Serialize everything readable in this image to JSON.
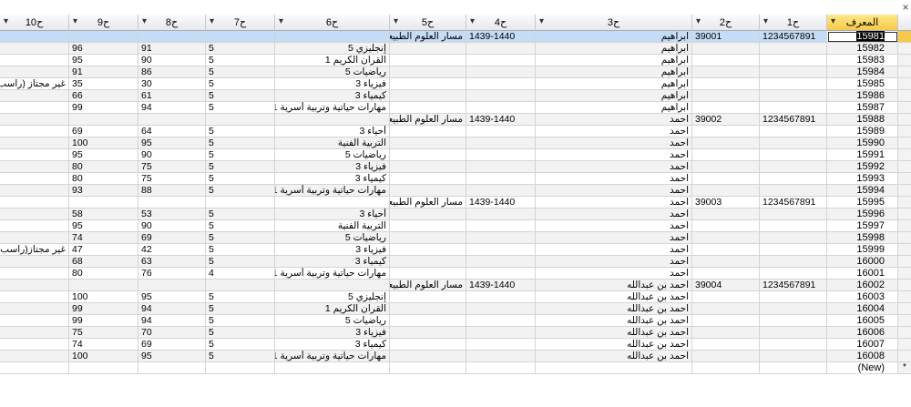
{
  "window": {
    "close_glyph": "×"
  },
  "columns": [
    "ﺍﻟﻤﻌﺮﻑ",
    "ﺡ1",
    "ﺡ2",
    "ﺡ3",
    "ﺡ4",
    "ﺡ5",
    "ﺡ6",
    "ﺡ7",
    "ﺡ8",
    "ﺡ9",
    "ﺡ10"
  ],
  "sort_arrow": "▾",
  "rows": [
    [
      "15981",
      "1234567891",
      "39001",
      "ابراهيم",
      "1439-1440",
      "مسار العلوم الطبيعية",
      "",
      "",
      "",
      "",
      ""
    ],
    [
      "15982",
      "",
      "",
      "ابراهيم",
      "",
      "",
      "إنجليزي 5",
      "5",
      "91",
      "96",
      ""
    ],
    [
      "15983",
      "",
      "",
      "ابراهيم",
      "",
      "",
      "القران الكريم 1",
      "5",
      "90",
      "95",
      ""
    ],
    [
      "15984",
      "",
      "",
      "ابراهيم",
      "",
      "",
      "رياضيات 5",
      "5",
      "86",
      "91",
      ""
    ],
    [
      "15985",
      "",
      "",
      "ابراهيم",
      "",
      "",
      "فيزياء 3",
      "5",
      "30",
      "35",
      "غير مجتاز (راسب)"
    ],
    [
      "15986",
      "",
      "",
      "ابراهيم",
      "",
      "",
      "كيمياء 3",
      "5",
      "61",
      "66",
      ""
    ],
    [
      "15987",
      "",
      "",
      "ابراهيم",
      "",
      "",
      "مهارات حياتية وتربية أسرية 1",
      "5",
      "94",
      "99",
      ""
    ],
    [
      "15988",
      "1234567891",
      "39002",
      "احمد",
      "1439-1440",
      "مسار العلوم الطبيعية",
      "",
      "",
      "",
      "",
      ""
    ],
    [
      "15989",
      "",
      "",
      "احمد",
      "",
      "",
      "أحياء 3",
      "5",
      "64",
      "69",
      ""
    ],
    [
      "15990",
      "",
      "",
      "احمد",
      "",
      "",
      "التربية الفنية",
      "5",
      "95",
      "100",
      ""
    ],
    [
      "15991",
      "",
      "",
      "احمد",
      "",
      "",
      "رياضيات 5",
      "5",
      "90",
      "95",
      ""
    ],
    [
      "15992",
      "",
      "",
      "احمد",
      "",
      "",
      "فيزياء 3",
      "5",
      "75",
      "80",
      ""
    ],
    [
      "15993",
      "",
      "",
      "احمد",
      "",
      "",
      "كيمياء 3",
      "5",
      "75",
      "80",
      ""
    ],
    [
      "15994",
      "",
      "",
      "احمد",
      "",
      "",
      "مهارات حياتية وتربية أسرية 1",
      "5",
      "88",
      "93",
      ""
    ],
    [
      "15995",
      "1234567891",
      "39003",
      "احمد",
      "1439-1440",
      "مسار العلوم الطبيعية",
      "",
      "",
      "",
      "",
      ""
    ],
    [
      "15996",
      "",
      "",
      "احمد",
      "",
      "",
      "أحياء 3",
      "5",
      "53",
      "58",
      ""
    ],
    [
      "15997",
      "",
      "",
      "احمد",
      "",
      "",
      "التربية الفنية",
      "5",
      "90",
      "95",
      ""
    ],
    [
      "15998",
      "",
      "",
      "احمد",
      "",
      "",
      "رياضيات 5",
      "5",
      "69",
      "74",
      ""
    ],
    [
      "15999",
      "",
      "",
      "احمد",
      "",
      "",
      "فيزياء 3",
      "5",
      "42",
      "47",
      "غير مجتاز(راسب)"
    ],
    [
      "16000",
      "",
      "",
      "احمد",
      "",
      "",
      "كيمياء 3",
      "5",
      "63",
      "68",
      ""
    ],
    [
      "16001",
      "",
      "",
      "احمد",
      "",
      "",
      "مهارات حياتية وتربية أسرية 1",
      "4",
      "76",
      "80",
      ""
    ],
    [
      "16002",
      "1234567891",
      "39004",
      "احمد بن عبدالله",
      "1439-1440",
      "مسار العلوم الطبيعية",
      "",
      "",
      "",
      "",
      ""
    ],
    [
      "16003",
      "",
      "",
      "احمد بن عبدالله",
      "",
      "",
      "إنجليزي 5",
      "5",
      "95",
      "100",
      ""
    ],
    [
      "16004",
      "",
      "",
      "احمد بن عبدالله",
      "",
      "",
      "القران الكريم 1",
      "5",
      "94",
      "99",
      ""
    ],
    [
      "16005",
      "",
      "",
      "احمد بن عبدالله",
      "",
      "",
      "رياضيات 5",
      "5",
      "94",
      "99",
      ""
    ],
    [
      "16006",
      "",
      "",
      "احمد بن عبدالله",
      "",
      "",
      "فيزياء 3",
      "5",
      "70",
      "75",
      ""
    ],
    [
      "16007",
      "",
      "",
      "احمد بن عبدالله",
      "",
      "",
      "كيمياء 3",
      "5",
      "69",
      "74",
      ""
    ],
    [
      "16008",
      "",
      "",
      "احمد بن عبدالله",
      "",
      "",
      "مهارات حياتية وتربية أسرية 1",
      "5",
      "95",
      "100",
      ""
    ]
  ],
  "new_row": {
    "label": "(New)",
    "marker": "*"
  },
  "current_row_marker": "▶",
  "colors": {
    "selected_row": "#c5dcf6",
    "active_header": "#f7c948",
    "alt_row": "#f2f2f2",
    "grid_line": "#d4d4d4"
  }
}
